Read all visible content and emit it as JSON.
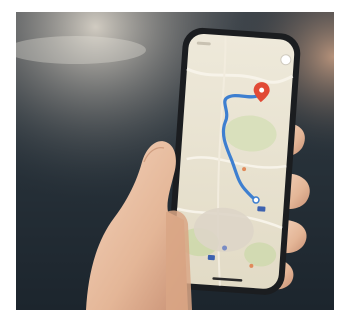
{
  "scene": {
    "subject": "hand-holding-smartphone",
    "screen_app": "map-navigation",
    "colors": {
      "background_road": "#27323b",
      "background_light": "#c9c6c0",
      "phone_frame": "#1b1d20",
      "map_base": "#e7e0cd",
      "map_green": "#cbd8a8",
      "route": "#3d7fd0",
      "destination_pin": "#e14a35",
      "skin": "#e9c2a6"
    }
  }
}
